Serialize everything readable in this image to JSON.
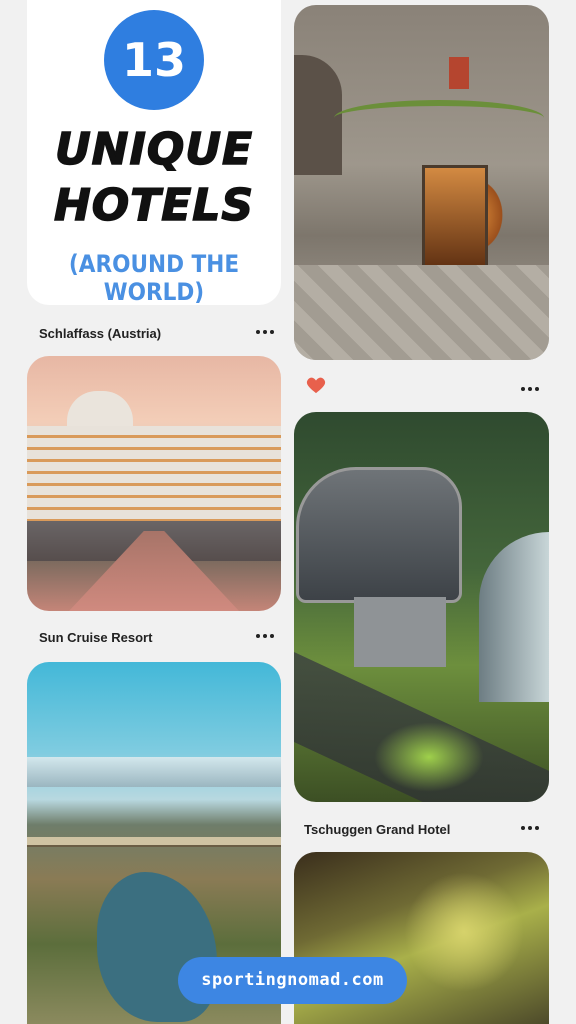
{
  "title_card": {
    "number": "13",
    "line1": "UNIQUE",
    "line2": "HOTELS",
    "subtitle": "(AROUND THE WORLD)",
    "badge_color": "#2f7ee0",
    "subtitle_color": "#4a90e2"
  },
  "pins": [
    {
      "caption": "Schlaffass (Austria)"
    },
    {
      "caption": "Sun Cruise Resort"
    },
    {
      "caption": "Tschuggen Grand Hotel"
    }
  ],
  "icons": {
    "more": "more-horizontal-icon",
    "heart": "heart-icon",
    "heart_color": "#e8604c"
  },
  "footer": {
    "site": "sportingnomad.com",
    "pill_color": "#3d86e3"
  }
}
